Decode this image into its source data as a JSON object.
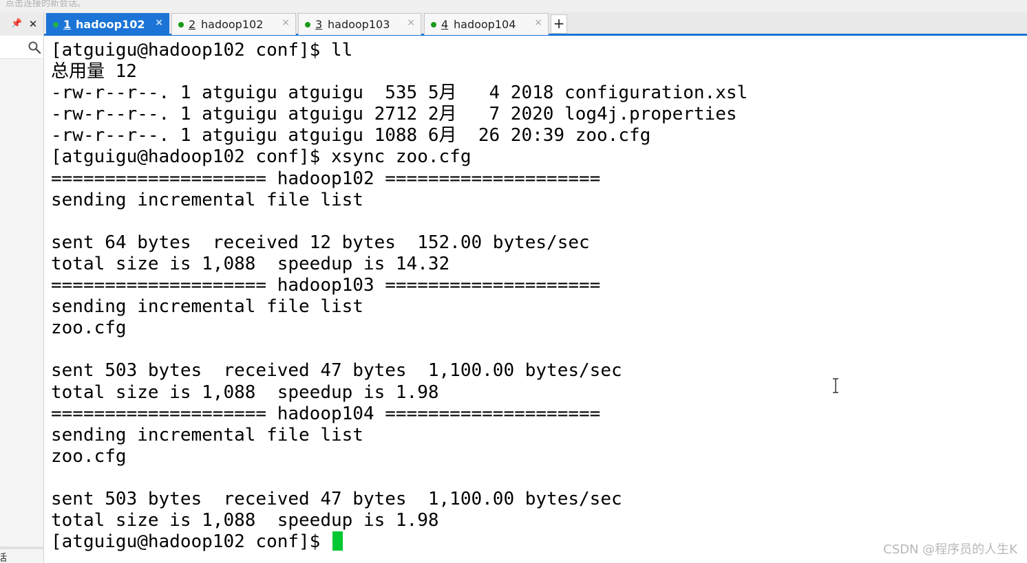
{
  "top_hint": "点击连接的新会话。",
  "left_panel": {
    "bottom_text": "话"
  },
  "tabs": [
    {
      "number": "1",
      "title": "hadoop102",
      "active": true
    },
    {
      "number": "2",
      "title": "hadoop102",
      "active": false
    },
    {
      "number": "3",
      "title": "hadoop103",
      "active": false
    },
    {
      "number": "4",
      "title": "hadoop104",
      "active": false
    }
  ],
  "new_tab_label": "+",
  "tab_close_glyph": "×",
  "icons": {
    "pin": "pin-icon",
    "panel_close": "close-icon",
    "search": "search-icon",
    "tab_status": "status-dot-icon",
    "cursor": "text-ibeam-icon"
  },
  "colors": {
    "active_tab": "#1b74d6",
    "status_dot": "#1a9a1a",
    "cursor": "#00c832"
  },
  "terminal": {
    "lines": [
      "[atguigu@hadoop102 conf]$ ll",
      "总用量 12",
      "-rw-r--r--. 1 atguigu atguigu  535 5月   4 2018 configuration.xsl",
      "-rw-r--r--. 1 atguigu atguigu 2712 2月   7 2020 log4j.properties",
      "-rw-r--r--. 1 atguigu atguigu 1088 6月  26 20:39 zoo.cfg",
      "[atguigu@hadoop102 conf]$ xsync zoo.cfg",
      "==================== hadoop102 ====================",
      "sending incremental file list",
      "",
      "sent 64 bytes  received 12 bytes  152.00 bytes/sec",
      "total size is 1,088  speedup is 14.32",
      "==================== hadoop103 ====================",
      "sending incremental file list",
      "zoo.cfg",
      "",
      "sent 503 bytes  received 47 bytes  1,100.00 bytes/sec",
      "total size is 1,088  speedup is 1.98",
      "==================== hadoop104 ====================",
      "sending incremental file list",
      "zoo.cfg",
      "",
      "sent 503 bytes  received 47 bytes  1,100.00 bytes/sec",
      "total size is 1,088  speedup is 1.98"
    ],
    "prompt": "[atguigu@hadoop102 conf]$ "
  },
  "watermark": "CSDN @程序员的人生K"
}
